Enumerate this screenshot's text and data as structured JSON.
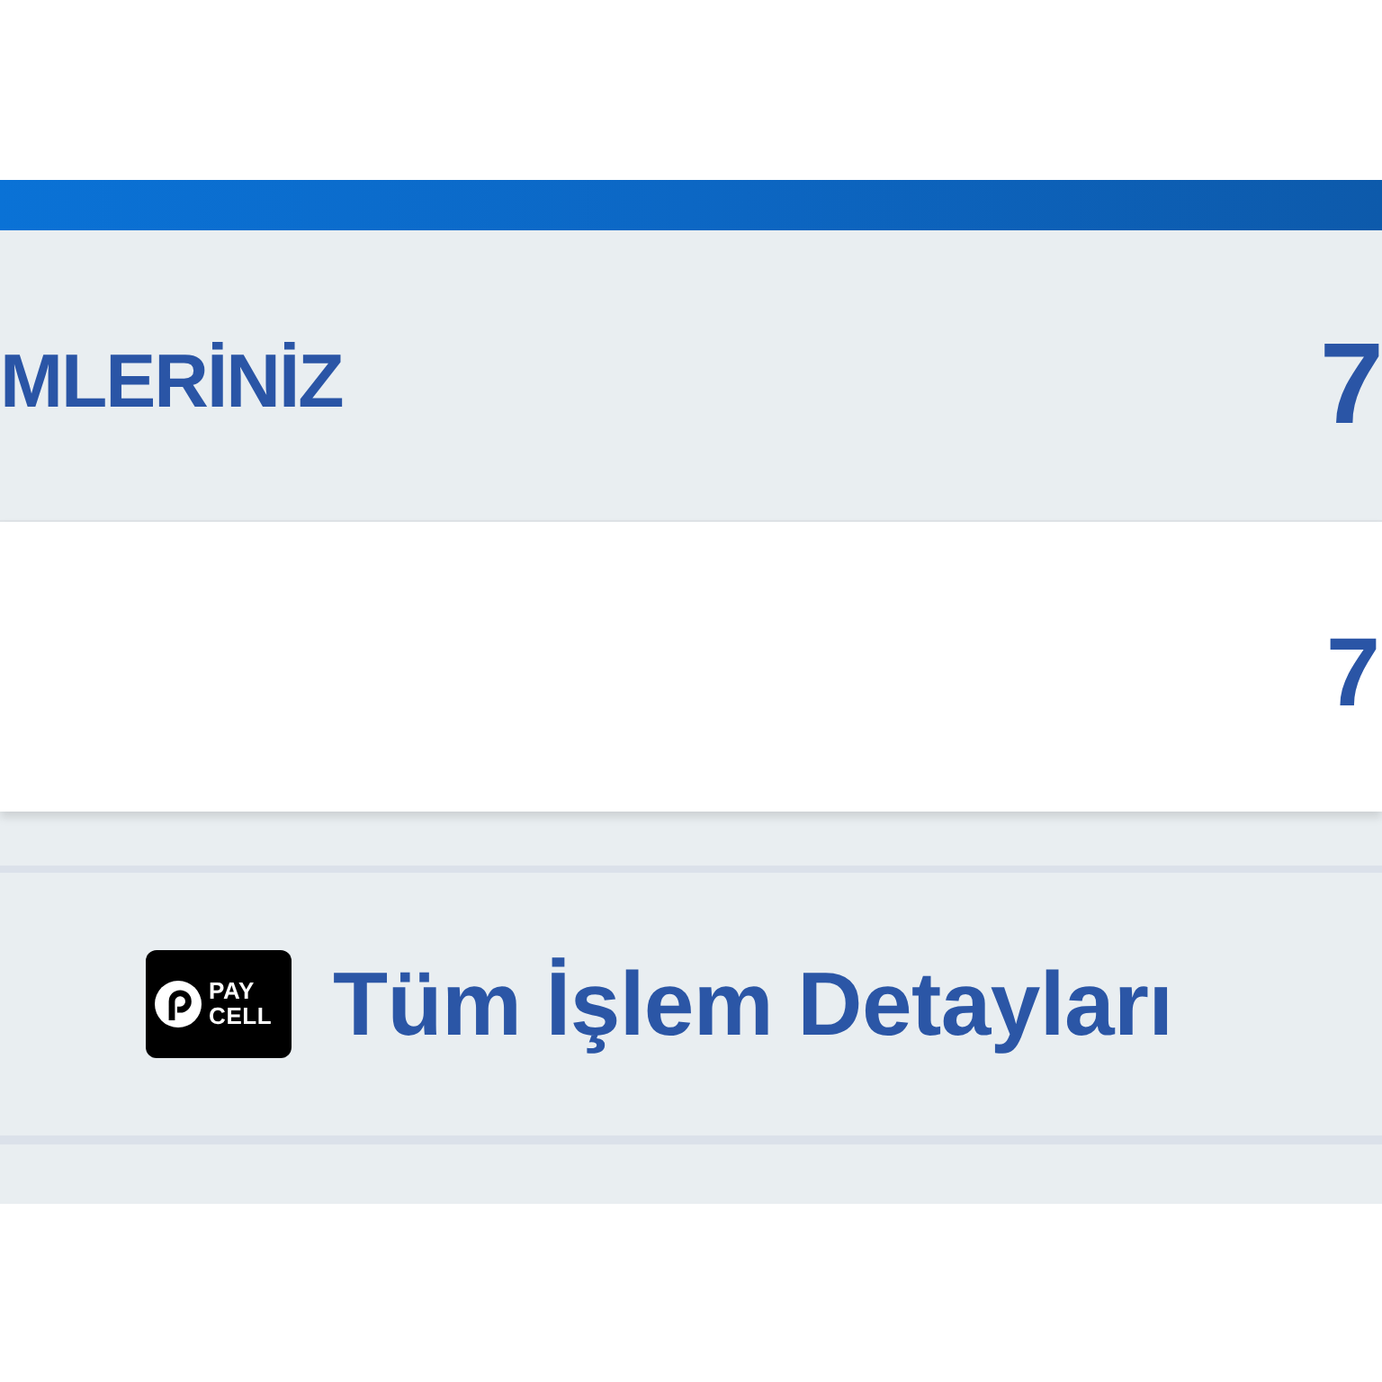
{
  "summary": {
    "header": {
      "title": "MLERİNİZ",
      "count": "7"
    },
    "rows": [
      {
        "value": "7"
      }
    ]
  },
  "details_link": {
    "logo_lines": [
      "PAY",
      "CELL"
    ],
    "label": "Tüm İşlem Detayları"
  }
}
